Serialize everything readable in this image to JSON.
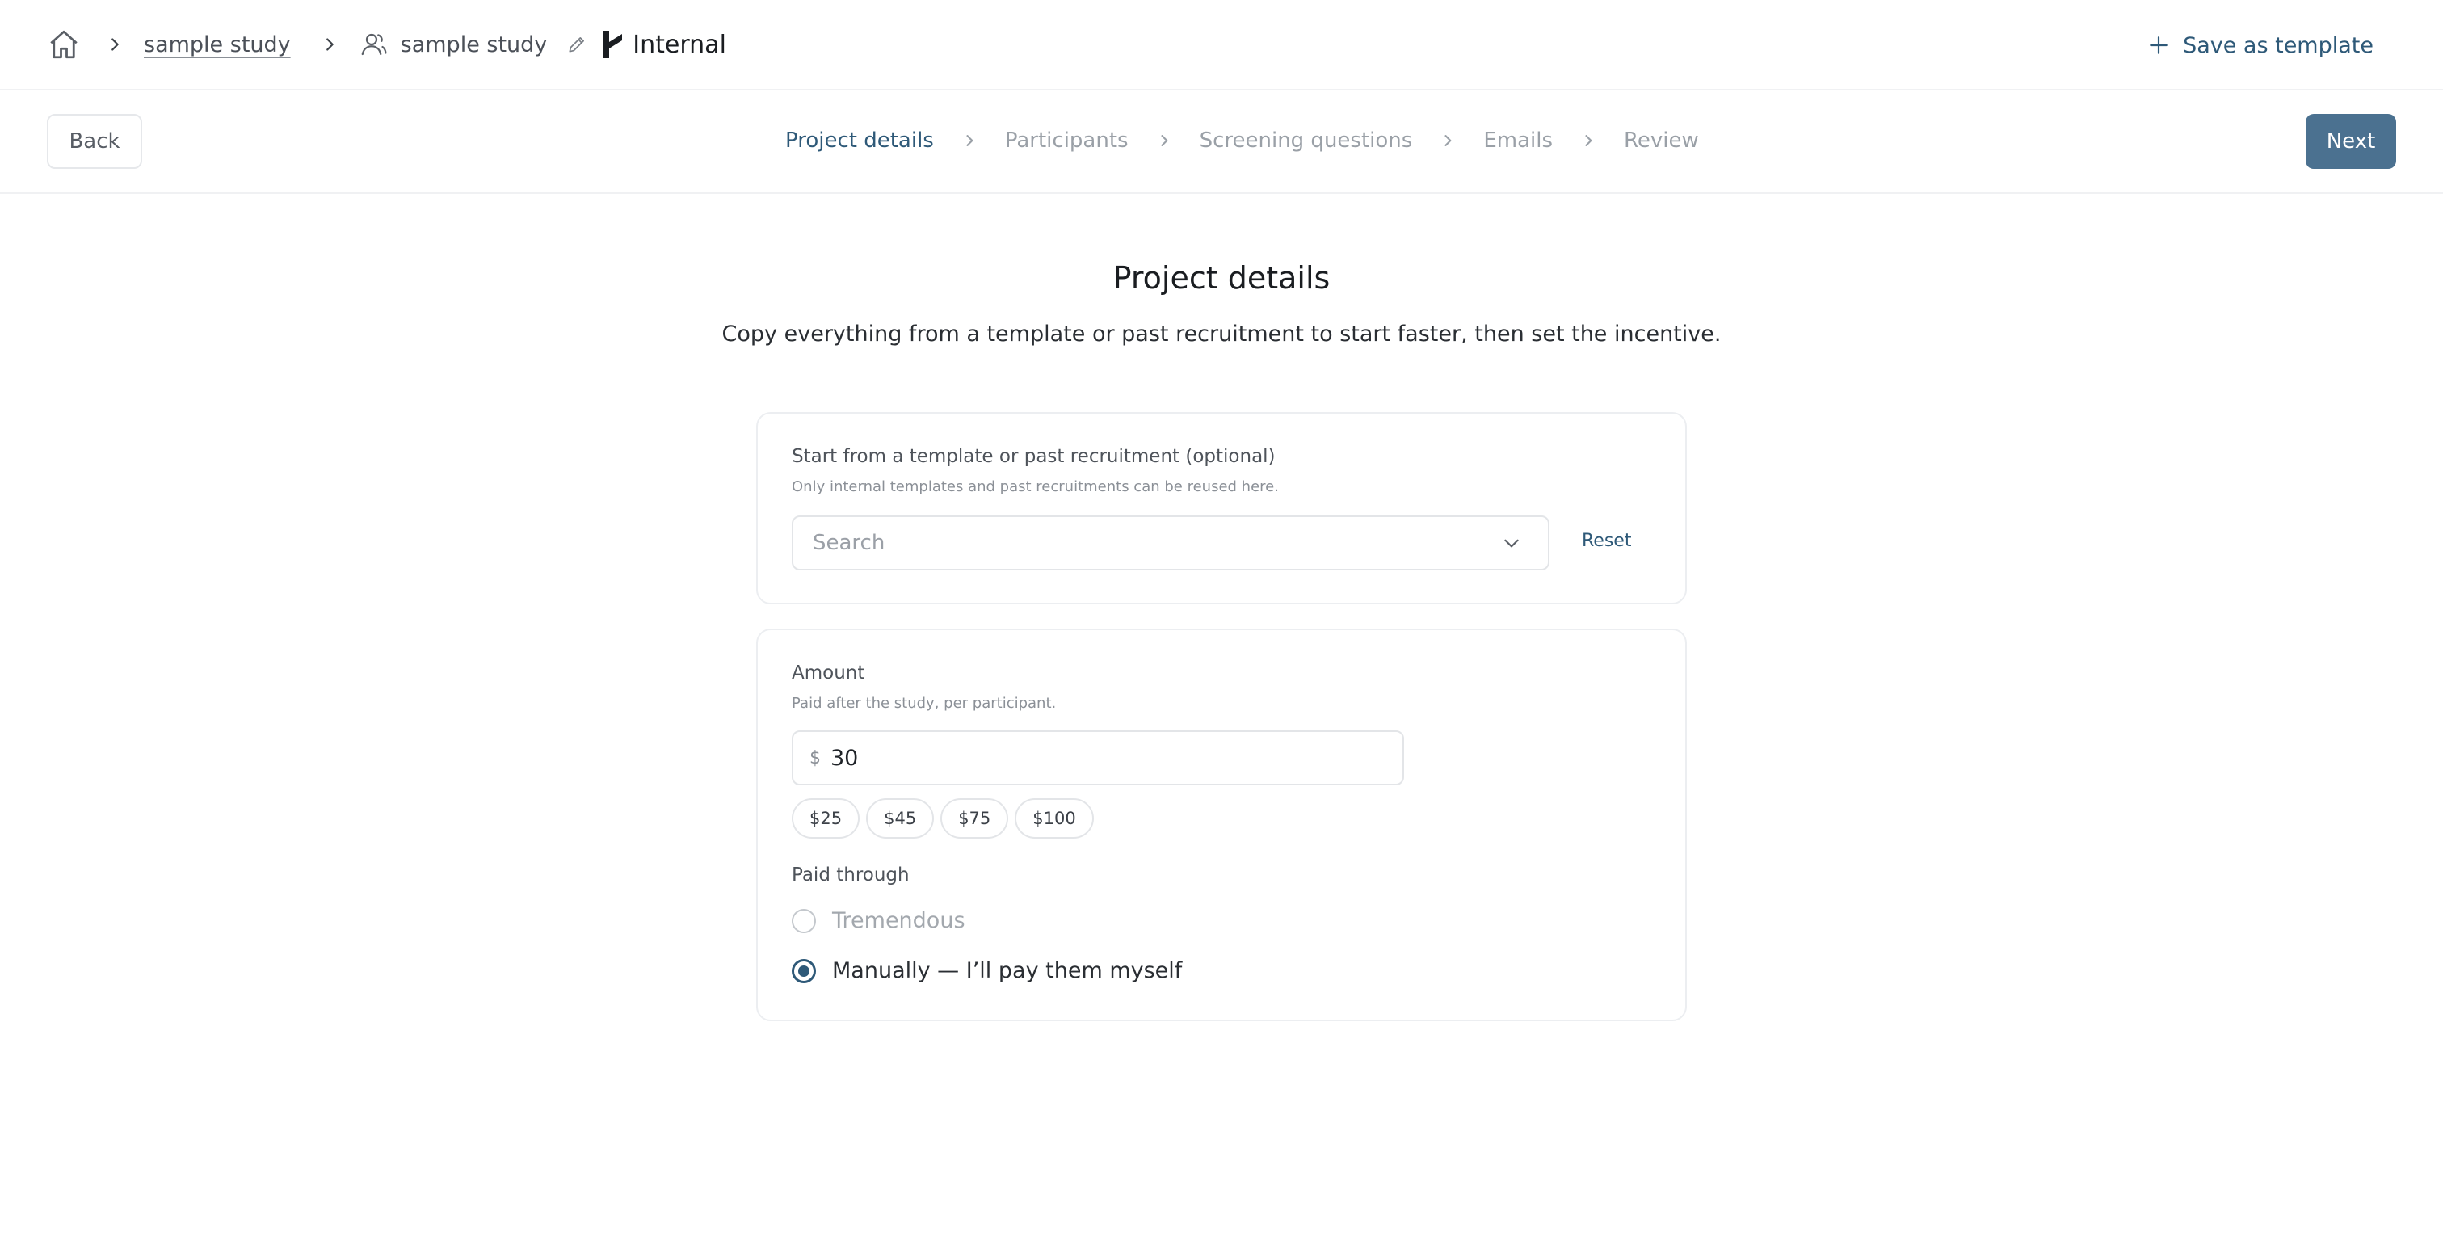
{
  "breadcrumb": {
    "study_link": "sample study",
    "study_name": "sample study",
    "workspace": "Internal"
  },
  "header": {
    "save_as_template_label": "Save as template"
  },
  "stepbar": {
    "back_label": "Back",
    "next_label": "Next",
    "steps": [
      {
        "label": "Project details",
        "state": "active"
      },
      {
        "label": "Participants",
        "state": "pending"
      },
      {
        "label": "Screening questions",
        "state": "pending"
      },
      {
        "label": "Emails",
        "state": "pending"
      },
      {
        "label": "Review",
        "state": "pending"
      }
    ]
  },
  "main": {
    "title": "Project details",
    "subtitle": "Copy everything from a template or past recruitment to start faster, then set the incentive."
  },
  "template_card": {
    "label": "Start from a template or past recruitment (optional)",
    "help": "Only internal templates and past recruitments can be reused here.",
    "search_placeholder": "Search",
    "search_value": "",
    "reset_label": "Reset"
  },
  "incentive_card": {
    "amount_label": "Amount",
    "amount_help": "Paid after the study, per participant.",
    "currency_symbol": "$",
    "amount_value": "30",
    "presets": [
      "$25",
      "$45",
      "$75",
      "$100"
    ],
    "paid_through_label": "Paid through",
    "options": [
      {
        "label": "Tremendous",
        "selected": false,
        "disabled": true
      },
      {
        "label": "Manually — I’ll pay them myself",
        "selected": true,
        "disabled": false
      }
    ]
  },
  "colors": {
    "accent": "#2e5978",
    "primary_button": "#4b7190",
    "muted_text": "#9aa0a7",
    "border": "#e3e5e8"
  },
  "icons": [
    "home-icon",
    "chevron-right-icon",
    "user-icon",
    "pencil-icon",
    "brand-logo",
    "plus-icon",
    "chevron-down-icon"
  ]
}
